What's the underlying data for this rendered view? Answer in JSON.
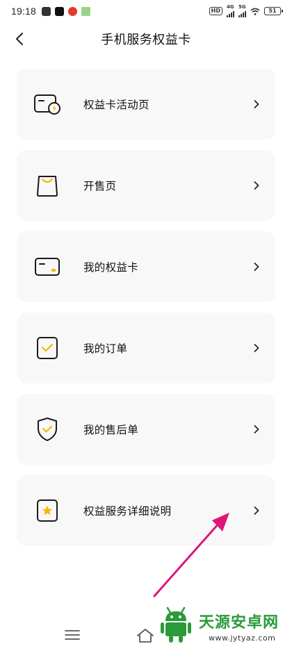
{
  "status_bar": {
    "time": "19:18",
    "hd_label": "HD",
    "network_1": "4G",
    "network_2": "5G",
    "battery": "51"
  },
  "header": {
    "title": "手机服务权益卡",
    "back_icon": "chevron-left-icon"
  },
  "menu": {
    "items": [
      {
        "label": "权益卡活动页",
        "icon": "card-lightning-icon"
      },
      {
        "label": "开售页",
        "icon": "shopping-bag-icon"
      },
      {
        "label": "我的权益卡",
        "icon": "card-icon"
      },
      {
        "label": "我的订单",
        "icon": "order-check-icon"
      },
      {
        "label": "我的售后单",
        "icon": "shield-check-icon"
      },
      {
        "label": "权益服务详细说明",
        "icon": "star-doc-icon"
      }
    ],
    "chevron_icon": "chevron-right-icon"
  },
  "annotation": {
    "color": "#e0157a"
  },
  "nav_bar": {
    "menu_icon": "hamburger-icon",
    "home_icon": "home-icon"
  },
  "watermark": {
    "title": "天源安卓网",
    "url": "www.jytyaz.com"
  },
  "colors": {
    "accent": "#f5b800",
    "card_bg": "#f8f8f8",
    "icon_stroke": "#1a1a1a"
  }
}
